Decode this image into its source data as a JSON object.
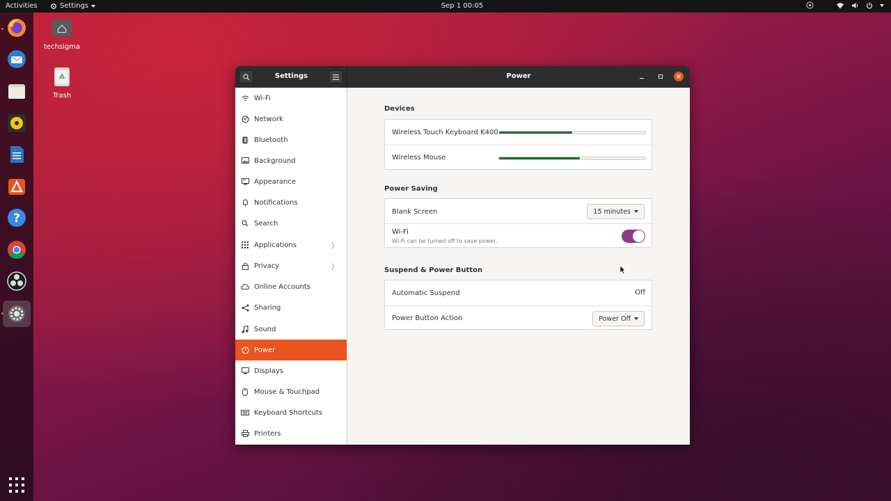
{
  "topbar": {
    "activities": "Activities",
    "app_menu": "Settings",
    "clock": "Sep 1  00:05"
  },
  "dock": {
    "items": [
      "firefox-icon",
      "thunderbird-icon",
      "files-icon",
      "rhythmbox-icon",
      "libreoffice-writer-icon",
      "software-icon",
      "help-icon",
      "chrome-icon",
      "obs-icon",
      "settings-icon"
    ],
    "show_apps": "grid-icon"
  },
  "desktop": {
    "home_label": "techsigma",
    "trash_label": "Trash"
  },
  "window": {
    "sidebar_title": "Settings",
    "panel_title": "Power"
  },
  "sidebar": {
    "items": [
      {
        "label": "Wi-Fi",
        "icon": "wifi-icon"
      },
      {
        "label": "Network",
        "icon": "network-icon"
      },
      {
        "label": "Bluetooth",
        "icon": "bluetooth-icon"
      },
      {
        "label": "Background",
        "icon": "background-icon"
      },
      {
        "label": "Appearance",
        "icon": "appearance-icon"
      },
      {
        "label": "Notifications",
        "icon": "bell-icon"
      },
      {
        "label": "Search",
        "icon": "search-icon"
      },
      {
        "label": "Applications",
        "icon": "applications-icon"
      },
      {
        "label": "Privacy",
        "icon": "lock-icon"
      },
      {
        "label": "Online Accounts",
        "icon": "cloud-icon"
      },
      {
        "label": "Sharing",
        "icon": "share-icon"
      },
      {
        "label": "Sound",
        "icon": "music-note-icon"
      },
      {
        "label": "Power",
        "icon": "power-icon"
      },
      {
        "label": "Displays",
        "icon": "display-icon"
      },
      {
        "label": "Mouse & Touchpad",
        "icon": "mouse-icon"
      },
      {
        "label": "Keyboard Shortcuts",
        "icon": "keyboard-icon"
      },
      {
        "label": "Printers",
        "icon": "printer-icon"
      }
    ],
    "active_index": 12
  },
  "power": {
    "devices": {
      "title": "Devices",
      "items": [
        {
          "name": "Wireless Touch Keyboard K400",
          "level": 0.5
        },
        {
          "name": "Wireless Mouse",
          "level": 0.55
        }
      ]
    },
    "saving": {
      "title": "Power Saving",
      "blank_screen_label": "Blank Screen",
      "blank_screen_value": "15 minutes",
      "wifi_label": "Wi-Fi",
      "wifi_sub": "Wi-Fi can be turned off to save power.",
      "wifi_on": true
    },
    "suspend": {
      "title": "Suspend & Power Button",
      "auto_suspend_label": "Automatic Suspend",
      "auto_suspend_value": "Off",
      "power_button_label": "Power Button Action",
      "power_button_value": "Power Off"
    }
  },
  "colors": {
    "accent": "#e95420",
    "toggle": "#8b3d88",
    "battery": "#1e6b2c"
  }
}
